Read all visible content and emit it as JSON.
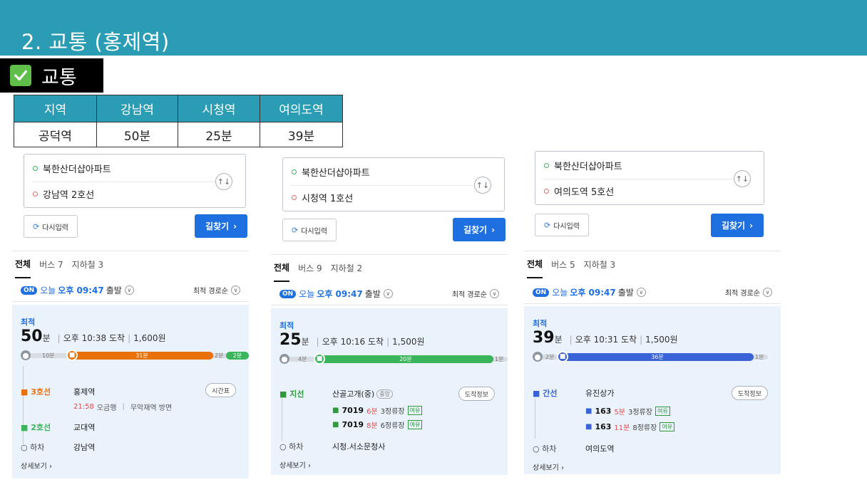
{
  "page": {
    "title": "2. 교통 (홍제역)"
  },
  "section": {
    "label": "교통"
  },
  "table": {
    "headers": [
      "지역",
      "강남역",
      "시청역",
      "여의도역"
    ],
    "row": [
      "공덕역",
      "50분",
      "25분",
      "39분"
    ]
  },
  "colors": {
    "band": "#2a9db4",
    "blue": "#1e6fe0",
    "orange": "#e8710a",
    "green_line": "#3bb55c",
    "blue_line": "#3a63d8"
  },
  "panels": [
    {
      "origin": "북한산더샵아파트",
      "destination": "강남역 2호선",
      "reset": "다시입력",
      "find": "길찾기",
      "tabs": [
        "전체",
        "버스 7",
        "지하철 3"
      ],
      "opt": {
        "on": "ON",
        "today": "오늘",
        "time": "오후 09:47",
        "dep": "출발",
        "sort": "최적 경로순"
      },
      "best": "최적",
      "minutes": "50",
      "unit": "분",
      "arrive": "오후 10:38 도착",
      "fare": "1,600원",
      "timeline": {
        "walk1": "10분",
        "seg": "31분",
        "walk2": "2분",
        "end": "2분"
      },
      "legs": [
        {
          "mode": "3호선",
          "station": "홍제역",
          "button": "시간표"
        },
        {
          "mode": "2호선",
          "station": "교대역"
        },
        {
          "mode": "하차",
          "station": "강남역"
        }
      ],
      "sub": {
        "time": "21:58",
        "info": "오금행",
        "dir": "무악재역 방면"
      },
      "more": "상세보기"
    },
    {
      "origin": "북한산더샵아파트",
      "destination": "시청역 1호선",
      "reset": "다시입력",
      "find": "길찾기",
      "tabs": [
        "전체",
        "버스 9",
        "지하철 2"
      ],
      "opt": {
        "on": "ON",
        "today": "오늘",
        "time": "오후 09:47",
        "dep": "출발",
        "sort": "최적 경로순"
      },
      "best": "최적",
      "minutes": "25",
      "unit": "분",
      "arrive": "오후 10:16 도착",
      "fare": "1,500원",
      "timeline": {
        "walk1": "4분",
        "seg": "20분",
        "walk2": "1분"
      },
      "legs": [
        {
          "mode": "지선",
          "station": "산골고개(중)",
          "tag": "중앙",
          "button": "도착정보"
        },
        {
          "mode": "하차",
          "station": "시청.서소문청사"
        }
      ],
      "buses": [
        {
          "num": "7019",
          "min": "6분",
          "stops": "3정류장",
          "status": "여유"
        },
        {
          "num": "7019",
          "min": "8분",
          "stops": "6정류장",
          "status": "여유"
        }
      ],
      "more": "상세보기"
    },
    {
      "origin": "북한산더샵아파트",
      "destination": "여의도역 5호선",
      "reset": "다시입력",
      "find": "길찾기",
      "tabs": [
        "전체",
        "버스 5",
        "지하철 3"
      ],
      "opt": {
        "on": "ON",
        "today": "오늘",
        "time": "오후 09:47",
        "dep": "출발",
        "sort": "최적 경로순"
      },
      "best": "최적",
      "minutes": "39",
      "unit": "분",
      "arrive": "오후 10:31 도착",
      "fare": "1,500원",
      "timeline": {
        "walk1": "2분",
        "seg": "36분",
        "walk2": "1분"
      },
      "legs": [
        {
          "mode": "간선",
          "station": "유진상가",
          "button": "도착정보"
        },
        {
          "mode": "하차",
          "station": "여의도역"
        }
      ],
      "buses": [
        {
          "num": "163",
          "min": "5분",
          "stops": "3정류장",
          "status": "여유"
        },
        {
          "num": "163",
          "min": "11분",
          "stops": "8정류장",
          "status": "여유"
        }
      ],
      "more": "상세보기"
    }
  ]
}
